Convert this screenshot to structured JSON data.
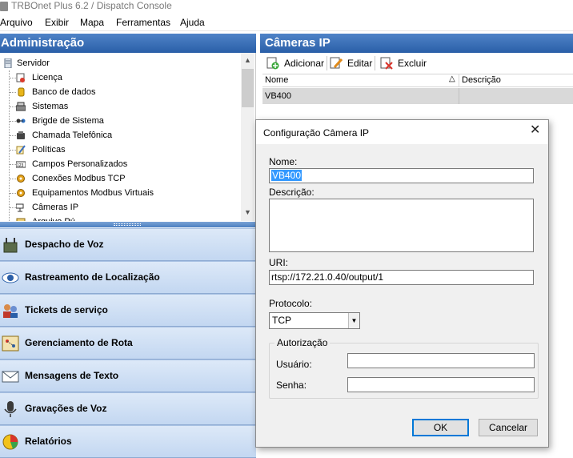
{
  "window": {
    "title": "TRBOnet Plus 6.2 / Dispatch Console"
  },
  "menu": [
    "Arquivo",
    "Exibir",
    "Mapa",
    "Ferramentas",
    "Ajuda"
  ],
  "admin": {
    "title": "Administração",
    "tree_root": "Servidor",
    "tree_items": [
      "Licença",
      "Banco de dados",
      "Sistemas",
      "Brigde de Sistema",
      "Chamada Telefônica",
      "Políticas",
      "Campos Personalizados",
      "Conexões Modbus TCP",
      "Equipamentos Modbus Virtuais",
      "Câmeras IP",
      "Arquivo Pú..."
    ]
  },
  "nav": [
    "Despacho de Voz",
    "Rastreamento de Localização",
    "Tickets de serviço",
    "Gerenciamento de Rota",
    "Mensagens de Texto",
    "Gravações de Voz",
    "Relatórios"
  ],
  "cameras": {
    "title": "Câmeras IP",
    "toolbar": {
      "add": "Adicionar",
      "edit": "Editar",
      "delete": "Excluir"
    },
    "columns": [
      "Nome",
      "Descrição"
    ],
    "rows": [
      {
        "name": "VB400",
        "description": ""
      }
    ]
  },
  "dialog": {
    "title": "Configuração Câmera IP",
    "name_label": "Nome:",
    "name_value": "VB400",
    "description_label": "Descrição:",
    "description_value": "",
    "uri_label": "URI:",
    "uri_value": "rtsp://172.21.0.40/output/1",
    "protocol_label": "Protocolo:",
    "protocol_value": "TCP",
    "auth_group": "Autorização",
    "user_label": "Usuário:",
    "user_value": "",
    "password_label": "Senha:",
    "password_value": "",
    "ok": "OK",
    "cancel": "Cancelar"
  },
  "colors": {
    "header_blue": "#2a5fa8",
    "nav_bg": "#c3d7f1",
    "selection": "#3399ff"
  }
}
